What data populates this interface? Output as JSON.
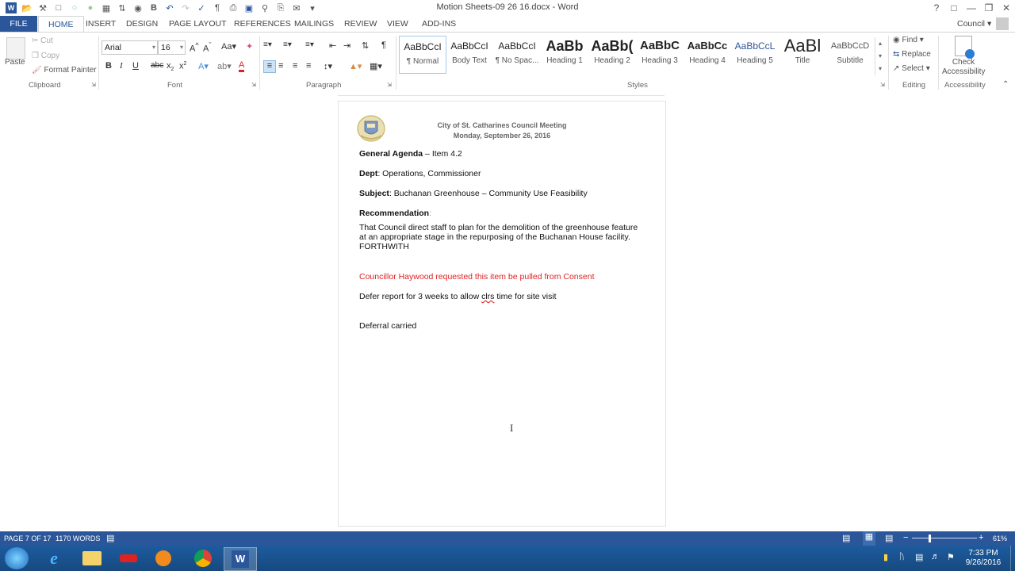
{
  "window": {
    "title": "Motion Sheets-09 26 16.docx - Word",
    "user": "Council"
  },
  "tabs": [
    "FILE",
    "HOME",
    "INSERT",
    "DESIGN",
    "PAGE LAYOUT",
    "REFERENCES",
    "MAILINGS",
    "REVIEW",
    "VIEW",
    "ADD-INS"
  ],
  "ribbon": {
    "clipboard": {
      "label": "Clipboard",
      "paste": "Paste",
      "cut": "Cut",
      "copy": "Copy",
      "format_painter": "Format Painter"
    },
    "font": {
      "label": "Font",
      "name": "Arial",
      "size": "16"
    },
    "paragraph": {
      "label": "Paragraph"
    },
    "styles": {
      "label": "Styles",
      "items": [
        {
          "preview": "AaBbCcI",
          "name": "¶ Normal"
        },
        {
          "preview": "AaBbCcI",
          "name": "Body Text"
        },
        {
          "preview": "AaBbCcI",
          "name": "¶ No Spac..."
        },
        {
          "preview": "AaBb",
          "name": "Heading 1"
        },
        {
          "preview": "AaBb(",
          "name": "Heading 2"
        },
        {
          "preview": "AaBbC",
          "name": "Heading 3"
        },
        {
          "preview": "AaBbCc",
          "name": "Heading 4"
        },
        {
          "preview": "AaBbCcL",
          "name": "Heading 5"
        },
        {
          "preview": "AaBl",
          "name": "Title"
        },
        {
          "preview": "AaBbCcD",
          "name": "Subtitle"
        }
      ]
    },
    "editing": {
      "label": "Editing",
      "find": "Find",
      "replace": "Replace",
      "select": "Select"
    },
    "accessibility": {
      "label": "Accessibility",
      "check_line1": "Check",
      "check_line2": "Accessibility"
    }
  },
  "document": {
    "header_line1": "City of St. Catharines Council Meeting",
    "header_line2": "Monday, September 26, 2016",
    "agenda_label": "General Agenda",
    "agenda_rest": " – Item 4.2",
    "dept_label": "Dept",
    "dept_rest": ": Operations, Commissioner",
    "subject_label": "Subject",
    "subject_rest": ": Buchanan Greenhouse – Community Use Feasibility",
    "recommendation_label": "Recommendation",
    "recommendation_colon": ":",
    "rec_line1": "That Council direct staff to plan for the demolition of the greenhouse feature",
    "rec_line2": "at an appropriate stage in the repurposing of the Buchanan House facility.",
    "rec_line3": "FORTHWITH",
    "councillor_note": "Councillor Haywood requested this item be pulled from Consent",
    "defer_before": "Defer report for 3 weeks to allow ",
    "defer_misspelled": "clrs",
    "defer_after": " time for site visit",
    "deferral": "Deferral carried"
  },
  "status": {
    "page": "PAGE 7 OF 17",
    "words": "1170 WORDS",
    "zoom": "61%"
  },
  "taskbar": {
    "time": "7:33 PM",
    "date": "9/26/2016"
  },
  "colors": {
    "word_blue": "#2b579a",
    "note_red": "#e02020"
  }
}
